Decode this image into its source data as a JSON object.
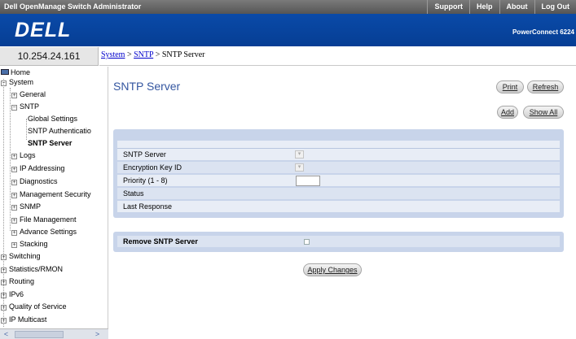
{
  "app": {
    "title": "Dell OpenManage Switch Administrator",
    "top_links": [
      "Support",
      "Help",
      "About",
      "Log Out"
    ],
    "logo": "DELL",
    "model": "PowerConnect 6224"
  },
  "ip_address": "10.254.24.161",
  "breadcrumb": {
    "system": "System",
    "sep1": " > ",
    "sntp": "SNTP",
    "sep2": " > ",
    "current": "SNTP Server"
  },
  "tree": {
    "home": "Home",
    "system": "System",
    "general": "General",
    "sntp": "SNTP",
    "global_settings": "Global Settings",
    "sntp_authentication": "SNTP Authenticatio",
    "sntp_server": "SNTP Server",
    "logs": "Logs",
    "ip_addressing": "IP Addressing",
    "diagnostics": "Diagnostics",
    "management_security": "Management Security",
    "snmp": "SNMP",
    "file_management": "File Management",
    "advance_settings": "Advance Settings",
    "stacking": "Stacking",
    "switching": "Switching",
    "statistics_rmon": "Statistics/RMON",
    "routing": "Routing",
    "ipv6": "IPv6",
    "quality_of_service": "Quality of Service",
    "ip_multicast": "IP Multicast"
  },
  "page": {
    "title": "SNTP Server",
    "buttons": {
      "print": "Print",
      "refresh": "Refresh",
      "add": "Add",
      "show_all": "Show All",
      "apply": "Apply Changes"
    },
    "form": {
      "sntp_server": "SNTP Server",
      "encryption_key_id": "Encryption Key ID",
      "priority": "Priority (1 - 8)",
      "status": "Status",
      "last_response": "Last Response"
    },
    "remove_label": "Remove SNTP Server"
  },
  "icons": {
    "expand": "plus-box-icon",
    "collapse": "minus-box-icon",
    "home": "home-icon",
    "dropdown": "chevron-down-icon",
    "scroll_left": "arrow-left-icon",
    "scroll_right": "arrow-right-icon"
  },
  "colors": {
    "banner": "#0a4aa8",
    "panel": "#c8d4ea",
    "title": "#3456a0",
    "link": "#0000cc"
  }
}
